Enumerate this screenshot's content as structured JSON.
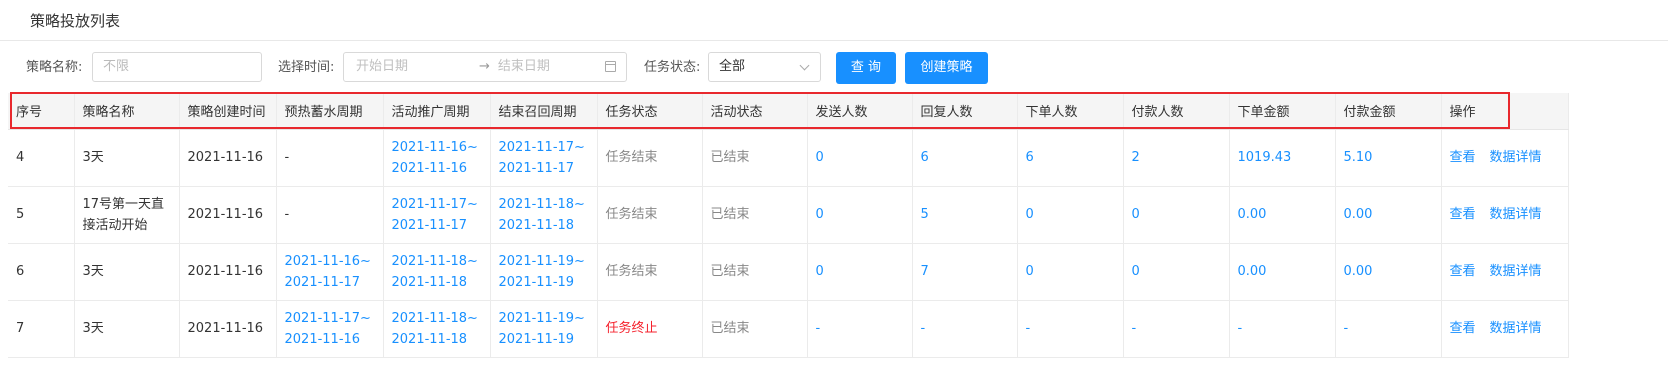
{
  "page_title": "策略投放列表",
  "filters": {
    "name_label": "策略名称:",
    "name_placeholder": "不限",
    "time_label": "选择时间:",
    "start_placeholder": "开始日期",
    "range_arrow": "→",
    "end_placeholder": "结束日期",
    "status_label": "任务状态:",
    "status_value": "全部",
    "query_button": "查 询",
    "create_button": "创建策略"
  },
  "table": {
    "columns": [
      "序号",
      "策略名称",
      "策略创建时间",
      "预热蓄水周期",
      "活动推广周期",
      "结束召回周期",
      "任务状态",
      "活动状态",
      "发送人数",
      "回复人数",
      "下单人数",
      "付款人数",
      "下单金额",
      "付款金额",
      "操作"
    ],
    "rows": [
      {
        "id": "4",
        "name": "3天",
        "created": "2021-11-16",
        "preheat": "-",
        "promo": "2021-11-16~\n2021-11-16",
        "recall": "2021-11-17~\n2021-11-17",
        "task_status": "任务结束",
        "activity_status": "已结束",
        "sent": "0",
        "replied": "6",
        "orders": "6",
        "paid": "2",
        "order_amount": "1019.43",
        "paid_amount": "5.10",
        "op_view": "查看",
        "op_detail": "数据详情"
      },
      {
        "id": "5",
        "name": "17号第一天直\n接活动开始",
        "created": "2021-11-16",
        "preheat": "-",
        "promo": "2021-11-17~\n2021-11-17",
        "recall": "2021-11-18~\n2021-11-18",
        "task_status": "任务结束",
        "activity_status": "已结束",
        "sent": "0",
        "replied": "5",
        "orders": "0",
        "paid": "0",
        "order_amount": "0.00",
        "paid_amount": "0.00",
        "op_view": "查看",
        "op_detail": "数据详情"
      },
      {
        "id": "6",
        "name": "3天",
        "created": "2021-11-16",
        "preheat": "2021-11-16~\n2021-11-17",
        "promo": "2021-11-18~\n2021-11-18",
        "recall": "2021-11-19~\n2021-11-19",
        "task_status": "任务结束",
        "activity_status": "已结束",
        "sent": "0",
        "replied": "7",
        "orders": "0",
        "paid": "0",
        "order_amount": "0.00",
        "paid_amount": "0.00",
        "op_view": "查看",
        "op_detail": "数据详情"
      },
      {
        "id": "7",
        "name": "3天",
        "created": "2021-11-16",
        "preheat": "2021-11-17~\n2021-11-16",
        "promo": "2021-11-18~\n2021-11-18",
        "recall": "2021-11-19~\n2021-11-19",
        "task_status": "任务终止",
        "activity_status": "已结束",
        "sent": "-",
        "replied": "-",
        "orders": "-",
        "paid": "-",
        "order_amount": "-",
        "paid_amount": "-",
        "op_view": "查看",
        "op_detail": "数据详情"
      }
    ]
  },
  "colors": {
    "accent": "#1890ff",
    "terminated": "#f5222d",
    "highlight": "#e8282d"
  }
}
